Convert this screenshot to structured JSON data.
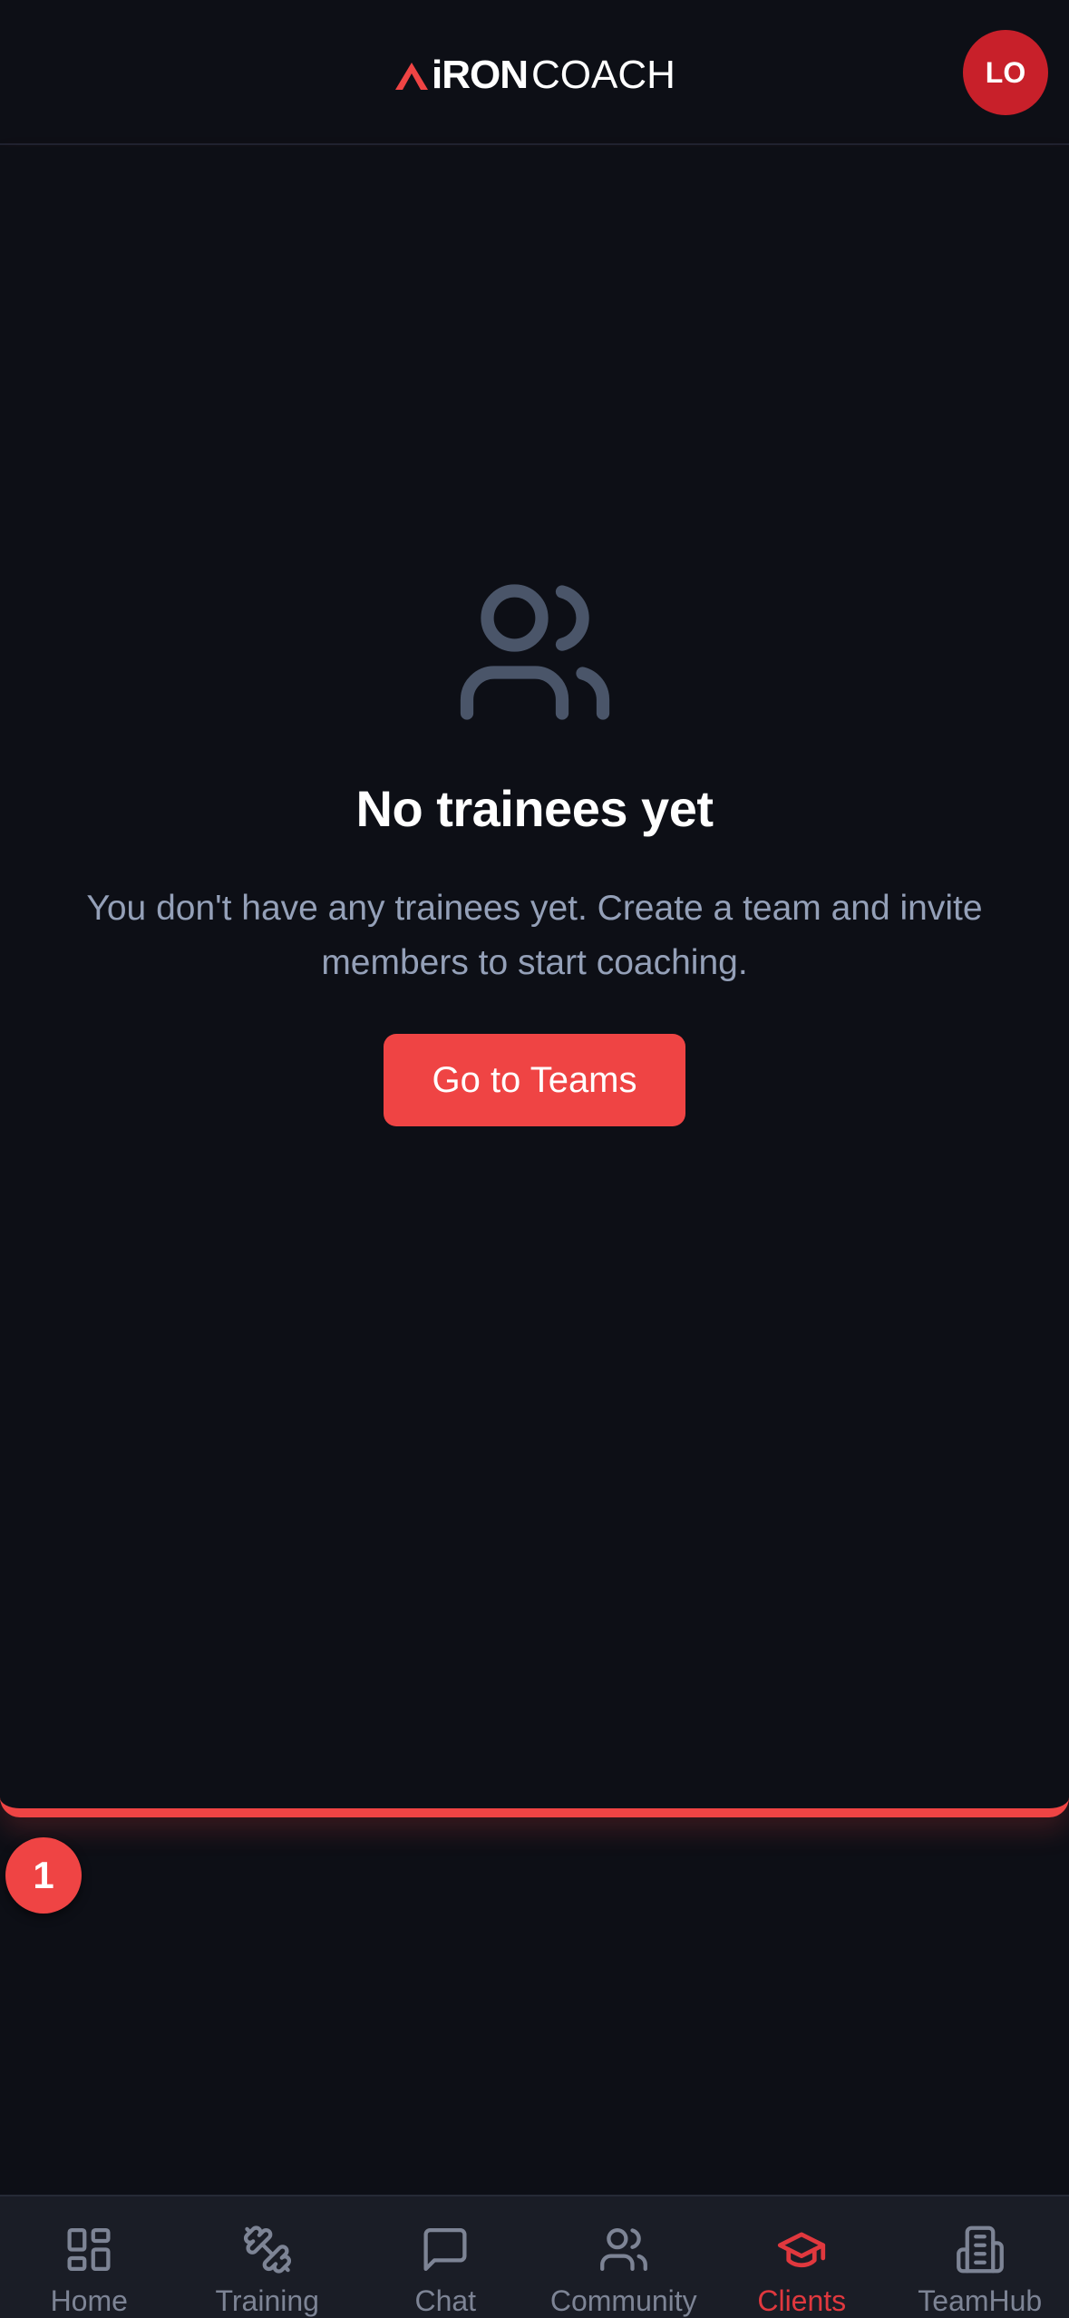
{
  "header": {
    "logo_brand": "iRON",
    "logo_suffix": "COACH",
    "avatar_initials": "LO"
  },
  "empty_state": {
    "icon": "users-icon",
    "title": "No trainees yet",
    "description": "You don't have any trainees yet. Create a team and invite members to start coaching.",
    "cta_label": "Go to Teams"
  },
  "step_badge": "1",
  "bottom_nav": {
    "items": [
      {
        "label": "Home",
        "icon": "grid-icon",
        "active": false
      },
      {
        "label": "Training",
        "icon": "dumbbell-icon",
        "active": false
      },
      {
        "label": "Chat",
        "icon": "chat-bubble-icon",
        "active": false
      },
      {
        "label": "Community",
        "icon": "users-icon",
        "active": false
      },
      {
        "label": "Clients",
        "icon": "graduation-cap-icon",
        "active": true
      },
      {
        "label": "TeamHub",
        "icon": "building-icon",
        "active": false
      }
    ]
  },
  "colors": {
    "background": "#0d0f16",
    "accent": "#ef4444",
    "muted_text": "#94a0b8",
    "nav_inactive": "#7d8495"
  }
}
